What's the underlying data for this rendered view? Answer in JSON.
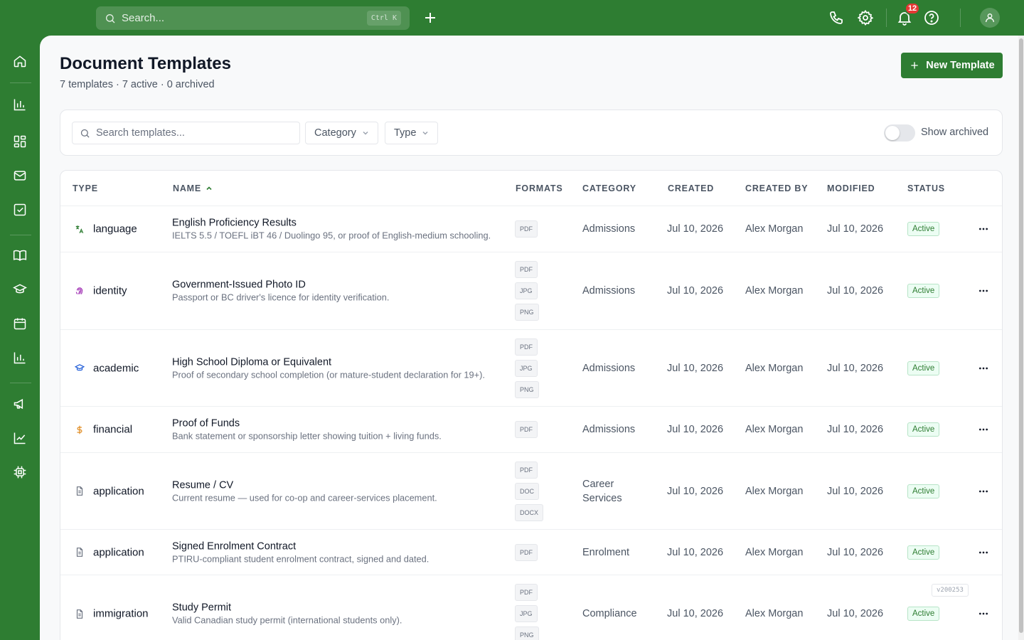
{
  "topbar": {
    "search_placeholder": "Search...",
    "search_shortcut": "Ctrl K",
    "notification_count": "12"
  },
  "sidebar": {
    "items": [
      "home-icon",
      "analytics-icon",
      "dashboard-icon",
      "mail-icon",
      "tasks-icon",
      "book-icon",
      "graduation-cap-icon",
      "calendar-icon",
      "reports-icon",
      "megaphone-icon",
      "trend-icon",
      "chip-icon"
    ]
  },
  "page": {
    "title": "Document Templates",
    "subtitle": "7 templates · 7 active · 0 archived",
    "new_button": "New Template"
  },
  "filters": {
    "search_placeholder": "Search templates...",
    "category_label": "Category",
    "type_label": "Type",
    "show_archived_label": "Show archived",
    "show_archived": false
  },
  "table": {
    "columns": [
      "TYPE",
      "NAME",
      "FORMATS",
      "CATEGORY",
      "CREATED",
      "CREATED BY",
      "MODIFIED",
      "STATUS"
    ],
    "sort_column": "NAME",
    "rows": [
      {
        "type": "language",
        "type_icon": "translate-icon",
        "icon_color": "#2e7d32",
        "name": "English Proficiency Results",
        "description": "IELTS 5.5 / TOEFL iBT 46 / Duolingo 95, or proof of English-medium schooling.",
        "formats": [
          "PDF"
        ],
        "category": "Admissions",
        "created": "Jul 10, 2026",
        "created_by": "Alex Morgan",
        "modified": "Jul 10, 2026",
        "status": "Active"
      },
      {
        "type": "identity",
        "type_icon": "fingerprint-icon",
        "icon_color": "#9c27b0",
        "name": "Government-Issued Photo ID",
        "description": "Passport or BC driver's licence for identity verification.",
        "formats": [
          "PDF",
          "JPG",
          "PNG"
        ],
        "category": "Admissions",
        "created": "Jul 10, 2026",
        "created_by": "Alex Morgan",
        "modified": "Jul 10, 2026",
        "status": "Active"
      },
      {
        "type": "academic",
        "type_icon": "graduation-cap-icon",
        "icon_color": "#1e5bd7",
        "name": "High School Diploma or Equivalent",
        "description": "Proof of secondary school completion (or mature-student declaration for 19+).",
        "formats": [
          "PDF",
          "JPG",
          "PNG"
        ],
        "category": "Admissions",
        "created": "Jul 10, 2026",
        "created_by": "Alex Morgan",
        "modified": "Jul 10, 2026",
        "status": "Active"
      },
      {
        "type": "financial",
        "type_icon": "dollar-icon",
        "icon_color": "#e08a1e",
        "name": "Proof of Funds",
        "description": "Bank statement or sponsorship letter showing tuition + living funds.",
        "formats": [
          "PDF"
        ],
        "category": "Admissions",
        "created": "Jul 10, 2026",
        "created_by": "Alex Morgan",
        "modified": "Jul 10, 2026",
        "status": "Active"
      },
      {
        "type": "application",
        "type_icon": "document-icon",
        "icon_color": "#6b7280",
        "name": "Resume / CV",
        "description": "Current resume — used for co-op and career-services placement.",
        "formats": [
          "PDF",
          "DOC",
          "DOCX"
        ],
        "category": "Career Services",
        "created": "Jul 10, 2026",
        "created_by": "Alex Morgan",
        "modified": "Jul 10, 2026",
        "status": "Active"
      },
      {
        "type": "application",
        "type_icon": "document-icon",
        "icon_color": "#6b7280",
        "name": "Signed Enrolment Contract",
        "description": "PTIRU-compliant student enrolment contract, signed and dated.",
        "formats": [
          "PDF"
        ],
        "category": "Enrolment",
        "created": "Jul 10, 2026",
        "created_by": "Alex Morgan",
        "modified": "Jul 10, 2026",
        "status": "Active"
      },
      {
        "type": "immigration",
        "type_icon": "document-icon",
        "icon_color": "#6b7280",
        "name": "Study Permit",
        "description": "Valid Canadian study permit (international students only).",
        "formats": [
          "PDF",
          "JPG",
          "PNG"
        ],
        "category": "Compliance",
        "created": "Jul 10, 2026",
        "created_by": "Alex Morgan",
        "modified": "Jul 10, 2026",
        "status": "Active"
      }
    ]
  },
  "version": "v200253"
}
